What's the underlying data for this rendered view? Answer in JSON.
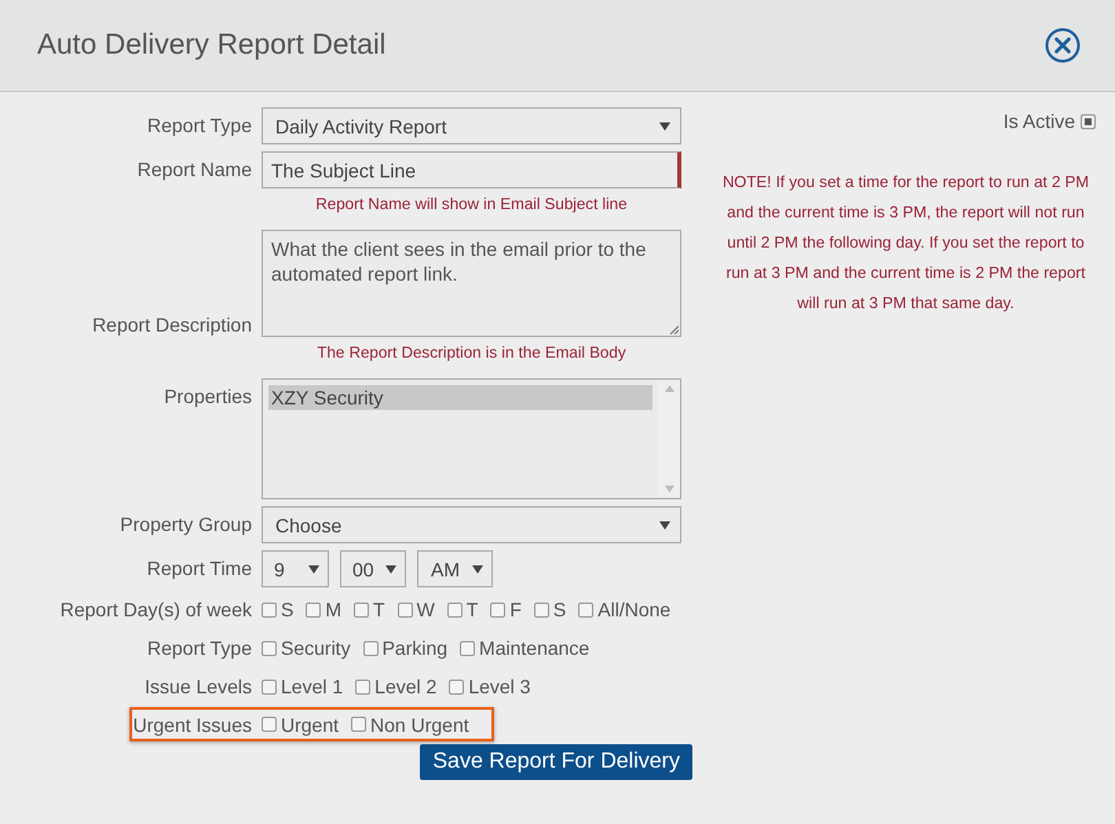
{
  "window": {
    "title": "Auto Delivery Report Detail"
  },
  "is_active": {
    "label": "Is Active",
    "checked": true
  },
  "note": "NOTE! If you set a time for the report to run at 2 PM and the current time is 3 PM, the report will not run until 2 PM the following day. If you set the report to run at 3 PM and the current time is 2 PM the report will run at 3 PM that same day.",
  "fields": [
    {
      "kind": "select",
      "label": "Report Type",
      "value": "Daily Activity Report"
    },
    {
      "kind": "text",
      "label": "Report Name",
      "value": "The Subject Line",
      "hint": "Report Name will show in Email Subject line"
    },
    {
      "kind": "textarea",
      "label": "Report Description",
      "value": "What the client sees in the email prior to the automated report link.",
      "hint": "The Report Description is in the Email Body"
    },
    {
      "kind": "listbox",
      "label": "Properties",
      "items": [
        {
          "label": "XZY Security",
          "selected": true
        }
      ]
    },
    {
      "kind": "select",
      "label": "Property Group",
      "value": "Choose"
    },
    {
      "kind": "time",
      "label": "Report Time",
      "parts": [
        "9",
        "00",
        "AM"
      ]
    },
    {
      "kind": "checks",
      "label": "Report Day(s) of week",
      "highlighted": false,
      "options": [
        {
          "label": "S",
          "checked": false
        },
        {
          "label": "M",
          "checked": false
        },
        {
          "label": "T",
          "checked": false
        },
        {
          "label": "W",
          "checked": false
        },
        {
          "label": "T",
          "checked": false
        },
        {
          "label": "F",
          "checked": false
        },
        {
          "label": "S",
          "checked": false
        },
        {
          "label": "All/None",
          "checked": false
        }
      ]
    },
    {
      "kind": "checks",
      "label": "Report Type",
      "highlighted": false,
      "options": [
        {
          "label": "Security",
          "checked": false
        },
        {
          "label": "Parking",
          "checked": false
        },
        {
          "label": "Maintenance",
          "checked": false
        }
      ]
    },
    {
      "kind": "checks",
      "label": "Issue Levels",
      "highlighted": false,
      "options": [
        {
          "label": "Level 1",
          "checked": false
        },
        {
          "label": "Level 2",
          "checked": false
        },
        {
          "label": "Level 3",
          "checked": false
        }
      ]
    },
    {
      "kind": "checks",
      "label": "Urgent Issues",
      "highlighted": true,
      "options": [
        {
          "label": "Urgent",
          "checked": false
        },
        {
          "label": "Non Urgent",
          "checked": false
        }
      ]
    }
  ],
  "save_button": "Save Report For Delivery"
}
